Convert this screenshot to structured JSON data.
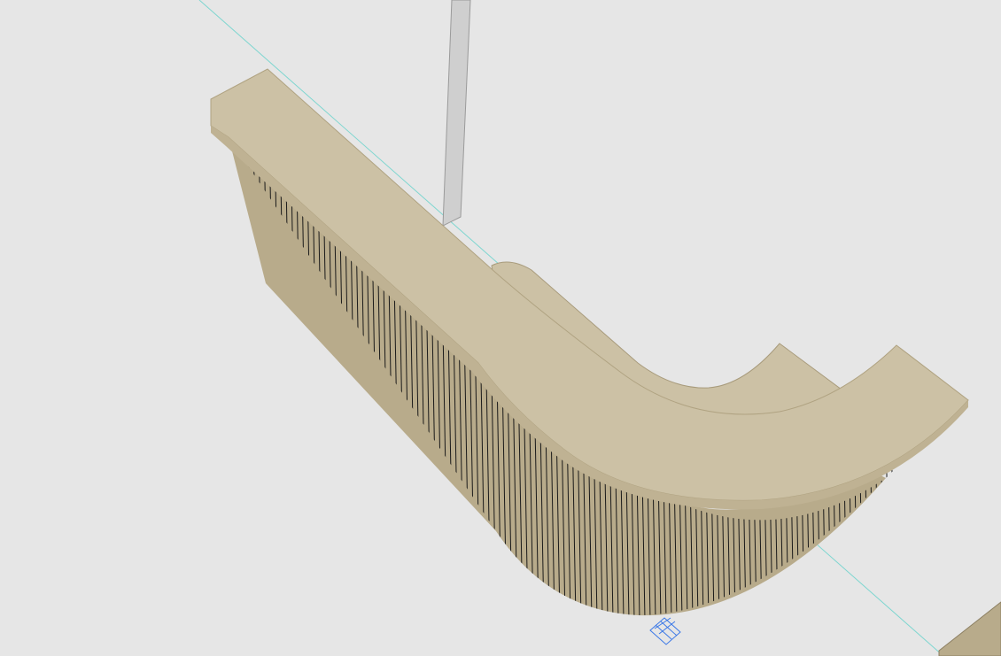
{
  "viewport": {
    "kind": "3d-model-view",
    "background_color": "#e6e6e6",
    "guide_line_color": "#7fd6d0",
    "cursor_icon": "grid-snap-cursor-icon",
    "cursor_color": "#3b78e7"
  },
  "model": {
    "object": "curved-reception-desk",
    "top_surface_color": "#ccc1a5",
    "front_face_color": "#bfb293",
    "slat_color": "#b8ab8b",
    "slat_line_color": "#1a1a1a",
    "wall_color": "#cfcfcf"
  }
}
